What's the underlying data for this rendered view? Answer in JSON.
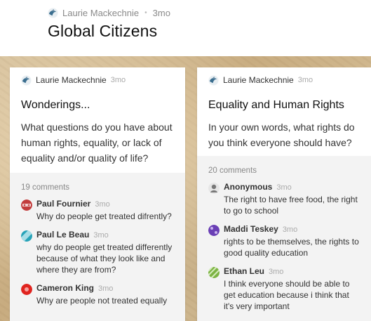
{
  "header": {
    "author": "Laurie Mackechnie",
    "separator": "•",
    "time": "3mo",
    "title": "Global Citizens"
  },
  "colors": {
    "background_texture": "#c8ac80",
    "card_bg": "#ffffff",
    "comments_bg": "#f3f3f3"
  },
  "posts": [
    {
      "author": "Laurie Mackechnie",
      "time": "3mo",
      "title": "Wonderings...",
      "body": "What questions do you have about human rights, equality, or lack of equality and/or quality of life?",
      "comment_count": "19 comments",
      "comments": [
        {
          "name": "Paul Fournier",
          "time": "3mo",
          "text": "Why do people get treated difrently?",
          "avatar_color": "#c23b3b",
          "avatar_icon": "patterned-avatar-icon"
        },
        {
          "name": "Paul Le Beau",
          "time": "3mo",
          "text": "why do people get treated differently because of what they look like and where they are from?",
          "avatar_color": "#27a3b8",
          "avatar_icon": "patterned-avatar-icon"
        },
        {
          "name": "Cameron King",
          "time": "3mo",
          "text": "Why are people not treated equally",
          "avatar_color": "#e0241f",
          "avatar_icon": "patterned-avatar-icon"
        }
      ]
    },
    {
      "author": "Laurie Mackechnie",
      "time": "3mo",
      "title": "Equality and Human Rights",
      "body": "In your own words, what rights do you think everyone should have?",
      "comment_count": "20 comments",
      "comments": [
        {
          "name": "Anonymous",
          "time": "3mo",
          "text": "The right to have free food, the right to go to school",
          "avatar_color": "#777777",
          "avatar_icon": "anonymous-avatar-icon"
        },
        {
          "name": "Maddi Teskey",
          "time": "3mo",
          "text": "rights to be themselves, the rights to good quality education",
          "avatar_color": "#6a3fb5",
          "avatar_icon": "patterned-avatar-icon"
        },
        {
          "name": "Ethan Leu",
          "time": "3mo",
          "text": "I think everyone should be able to get education because i think that it's very important",
          "avatar_color": "#7cb342",
          "avatar_icon": "patterned-avatar-icon"
        }
      ]
    }
  ]
}
